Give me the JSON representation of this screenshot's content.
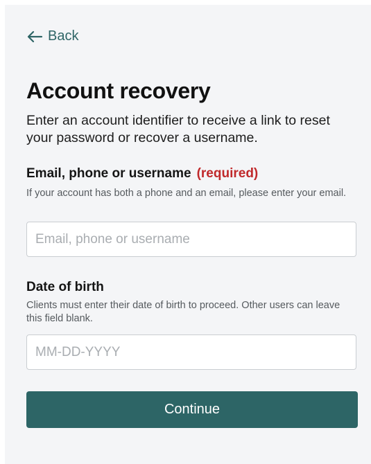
{
  "nav": {
    "back_label": "Back"
  },
  "header": {
    "title": "Account recovery",
    "description": "Enter an account identifier to receive a link to reset your password or recover a username."
  },
  "form": {
    "identifier": {
      "label": "Email, phone or username",
      "required_label": "(required)",
      "help": "If your account has both a phone and an email, please enter your email.",
      "placeholder": "Email, phone or username",
      "value": ""
    },
    "dob": {
      "label": "Date of birth",
      "help": "Clients must enter their date of birth to proceed. Other users can leave this field blank.",
      "placeholder": "MM-DD-YYYY",
      "value": ""
    },
    "submit_label": "Continue"
  },
  "colors": {
    "accent": "#2d6566",
    "required": "#c0292b",
    "background": "#f4f5f7"
  },
  "icons": {
    "back": "arrow-left-icon"
  }
}
